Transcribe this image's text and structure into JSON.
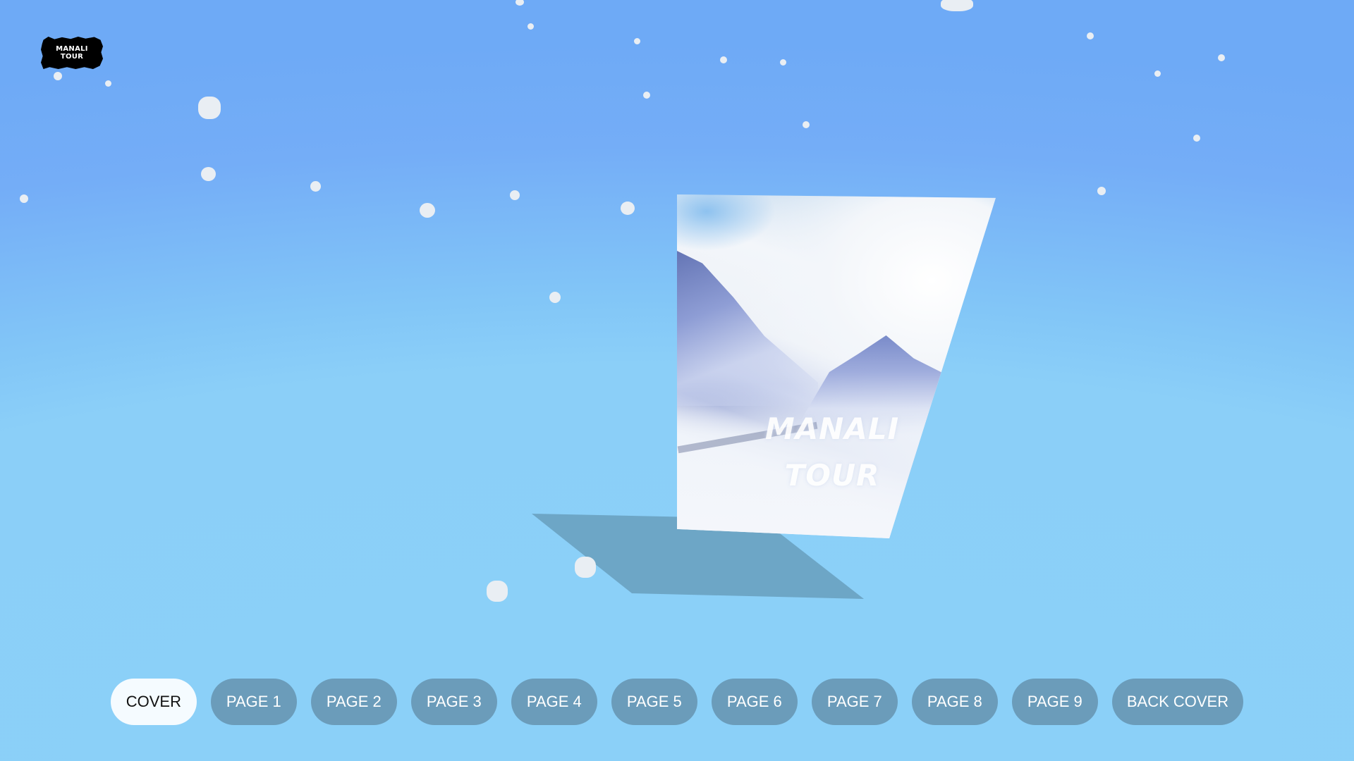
{
  "logo": {
    "line1": "MANALI",
    "line2": "TOUR"
  },
  "book": {
    "cover_title_line1": "MANALI",
    "cover_title_line2": "TOUR"
  },
  "nav": {
    "buttons": [
      {
        "label": "COVER",
        "active": true
      },
      {
        "label": "PAGE 1"
      },
      {
        "label": "PAGE 2"
      },
      {
        "label": "PAGE 3"
      },
      {
        "label": "PAGE 4"
      },
      {
        "label": "PAGE 5"
      },
      {
        "label": "PAGE 6"
      },
      {
        "label": "PAGE 7"
      },
      {
        "label": "PAGE 8"
      },
      {
        "label": "PAGE 9"
      },
      {
        "label": "BACK COVER"
      }
    ]
  },
  "colors": {
    "sky_top": "#6eaaf6",
    "sky_bottom": "#8bd0f8",
    "button": "#6b9cba",
    "button_active": "#f5fbff",
    "shadow": "#6da6c6"
  }
}
